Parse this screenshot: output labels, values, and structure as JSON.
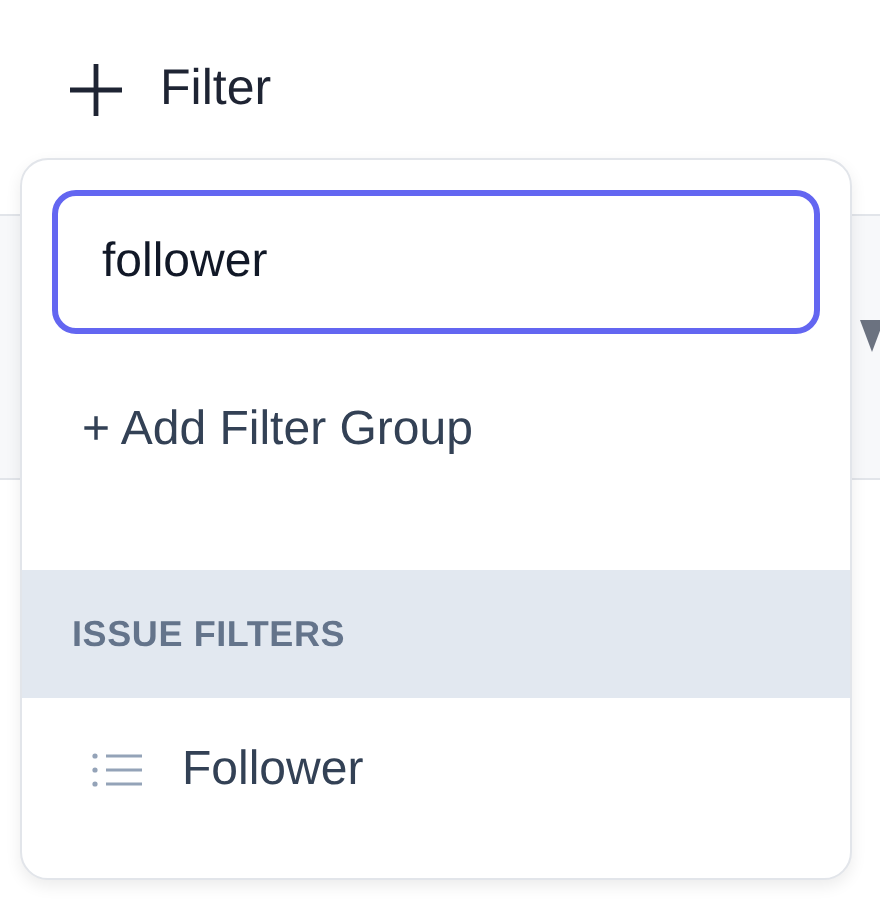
{
  "filter_button": {
    "label": "Filter"
  },
  "dropdown": {
    "search": {
      "value": "follower"
    },
    "add_group": "+ Add Filter Group",
    "sections": [
      {
        "title": "ISSUE FILTERS",
        "items": [
          {
            "label": "Follower"
          }
        ]
      }
    ]
  }
}
